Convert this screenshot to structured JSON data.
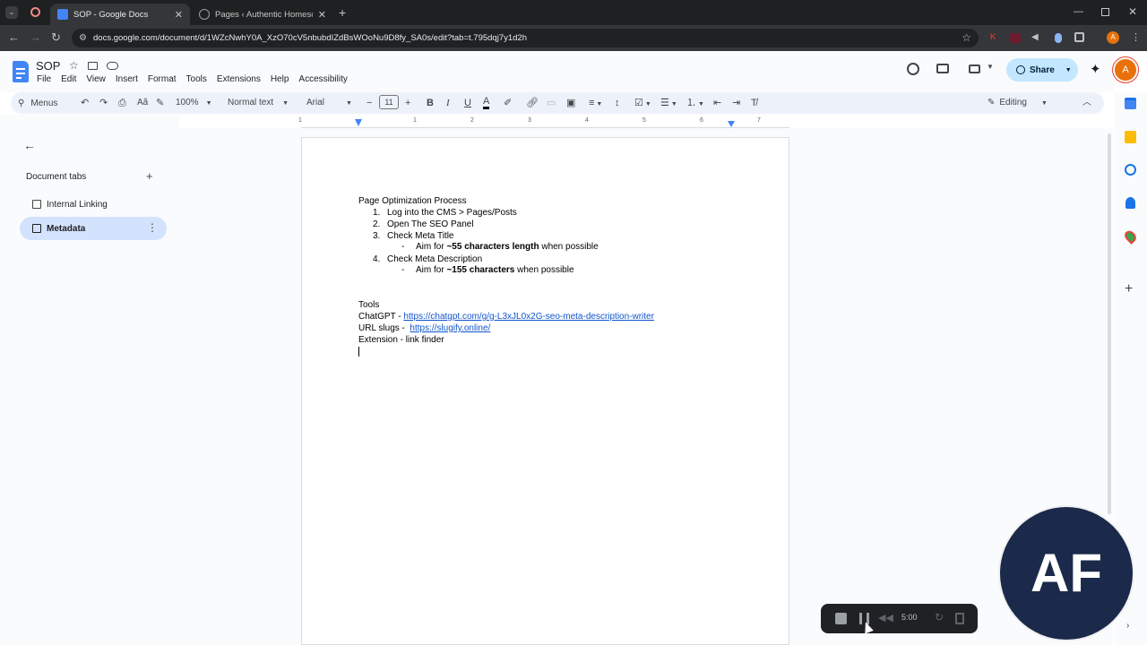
{
  "browser": {
    "tabs": [
      {
        "title": "SOP - Google Docs",
        "active": true
      },
      {
        "title": "Pages ‹ Authentic Homescapes",
        "active": false
      }
    ],
    "url": "docs.google.com/document/d/1WZcNwhY0A_XzO70cV5nbubdIZdBsWOoNu9D8fy_SA0s/edit?tab=t.795dqj7y1d2h"
  },
  "docs": {
    "title": "SOP",
    "menu": [
      "File",
      "Edit",
      "View",
      "Insert",
      "Format",
      "Tools",
      "Extensions",
      "Help",
      "Accessibility"
    ],
    "share_label": "Share",
    "avatar_letter": "A",
    "toolbar": {
      "menus_label": "Menus",
      "zoom": "100%",
      "style": "Normal text",
      "font": "Arial",
      "font_size": "11",
      "mode": "Editing"
    }
  },
  "sidebar": {
    "heading": "Document tabs",
    "tabs": [
      {
        "label": "Internal Linking",
        "selected": false
      },
      {
        "label": "Metadata",
        "selected": true
      }
    ]
  },
  "ruler": {
    "ticks": [
      "1",
      "1",
      "2",
      "3",
      "4",
      "5",
      "6",
      "7"
    ]
  },
  "document": {
    "heading": "Page Optimization Process",
    "steps": [
      {
        "num": "1.",
        "text": "Log into the CMS > Pages/Posts"
      },
      {
        "num": "2.",
        "text": "Open The SEO Panel"
      },
      {
        "num": "3.",
        "text": "Check Meta Title"
      },
      {
        "num": "4.",
        "text": "Check Meta Description"
      }
    ],
    "sub1": {
      "bullet": "-",
      "pre": "Aim for ",
      "bold": "~55 characters length",
      "post": " when possible"
    },
    "sub2": {
      "bullet": "-",
      "pre": "Aim for ",
      "bold": "~155 characters",
      "post": " when possible"
    },
    "tools_heading": "Tools",
    "tools": [
      {
        "label": "ChatGPT - ",
        "link": "https://chatgpt.com/g/g-L3xJL0x2G-seo-meta-description-writer"
      },
      {
        "label": "URL slugs -  ",
        "link": "https://slugify.online/"
      },
      {
        "label": "Extension - link finder",
        "link": ""
      }
    ]
  },
  "recorder": {
    "time": "5:00"
  },
  "overlay_avatar": "AF",
  "colors": {
    "accent": "#0b57d0",
    "selected_tab": "#d3e3fd",
    "link": "#1155cc",
    "avatar_bg": "#1b2a4a"
  }
}
